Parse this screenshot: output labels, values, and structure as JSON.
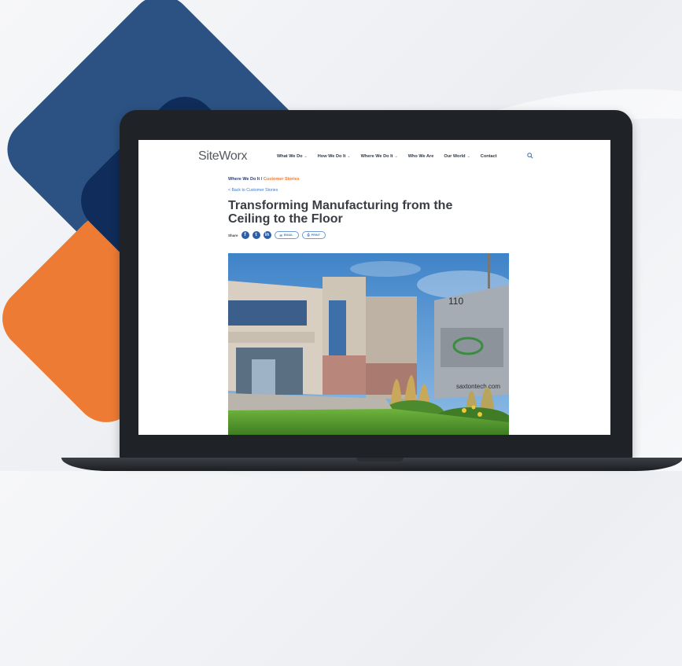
{
  "site": {
    "logo": "SiteWorx",
    "nav": [
      {
        "label": "What We Do",
        "dropdown": true
      },
      {
        "label": "How We Do It",
        "dropdown": true
      },
      {
        "label": "Where We Do It",
        "dropdown": true
      },
      {
        "label": "Who We Are",
        "dropdown": false
      },
      {
        "label": "Our World",
        "dropdown": true
      },
      {
        "label": "Contact",
        "dropdown": false
      }
    ],
    "search_icon": "search-icon"
  },
  "article": {
    "breadcrumb_parent": "Where We Do It /",
    "breadcrumb_current": "Customer Stories",
    "back_link": "< Back to Customer Stories",
    "title": "Transforming Manufacturing from the Ceiling to the Floor",
    "share_label": "Share",
    "social": [
      "f",
      "t",
      "in"
    ],
    "email_label": "EMAIL",
    "print_label": "PRINT",
    "photo": {
      "sign_number": "110",
      "sign_url": "saxtontech.com"
    }
  },
  "colors": {
    "brand_blue": "#2c5283",
    "brand_navy": "#0f2c5a",
    "brand_orange": "#ee7b33",
    "link_blue": "#3c79c9"
  }
}
